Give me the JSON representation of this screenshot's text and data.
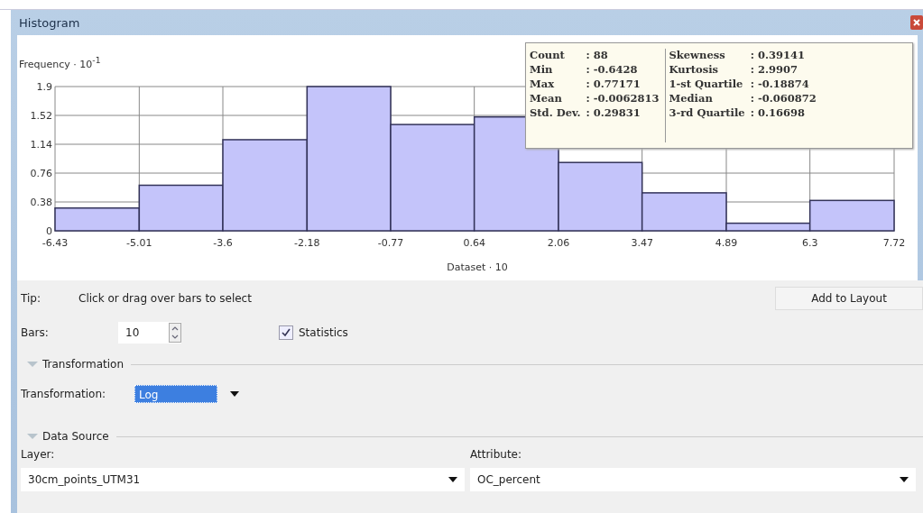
{
  "window": {
    "title": "Histogram"
  },
  "chart": {
    "chart_data": {
      "type": "bar",
      "ylabel": "Frequency · 10$^{-1}$",
      "xlabel": "Dataset · 10",
      "x": [
        -5.72,
        -4.305,
        -2.89,
        -1.475,
        -0.065,
        1.35,
        2.765,
        4.18,
        5.595,
        7.01
      ],
      "xticks": [
        {
          "value": -6.43,
          "label": "-6.43"
        },
        {
          "value": -5.01,
          "label": "-5.01"
        },
        {
          "value": -3.6,
          "label": "-3.6"
        },
        {
          "value": -2.18,
          "label": "-2.18"
        },
        {
          "value": -0.77,
          "label": "-0.77"
        },
        {
          "value": 0.64,
          "label": "0.64"
        },
        {
          "value": 2.06,
          "label": "2.06"
        },
        {
          "value": 3.47,
          "label": "3.47"
        },
        {
          "value": 4.89,
          "label": "4.89"
        },
        {
          "value": 6.3,
          "label": "6.3"
        },
        {
          "value": 7.72,
          "label": "7.72"
        }
      ],
      "yticks": [
        0,
        0.38,
        0.76,
        1.14,
        1.52,
        1.9
      ],
      "xlim": [
        -6.43,
        7.72
      ],
      "ylim": [
        0,
        1.9
      ],
      "grid": true,
      "series": [
        {
          "color": "#c4c4fa",
          "values": [
            0.3,
            0.6,
            1.2,
            1.9,
            1.4,
            1.5,
            0.9,
            0.5,
            0.1,
            0.4
          ]
        }
      ]
    }
  },
  "statistics_box": {
    "left": [
      {
        "label": "Count",
        "value": ": 88"
      },
      {
        "label": "Min",
        "value": ": -0.6428"
      },
      {
        "label": "Max",
        "value": ": 0.77171"
      },
      {
        "label": "Mean",
        "value": ": -0.0062813"
      },
      {
        "label": "Std. Dev.",
        "value": ": 0.29831"
      }
    ],
    "right": [
      {
        "label": "Skewness",
        "value": ": 0.39141"
      },
      {
        "label": "Kurtosis",
        "value": ": 2.9907"
      },
      {
        "label": "1-st Quartile",
        "value": ": -0.18874"
      },
      {
        "label": "Median",
        "value": ": -0.060872"
      },
      {
        "label": "3-rd Quartile",
        "value": ": 0.16698"
      }
    ]
  },
  "tip": {
    "label": "Tip:",
    "text": "Click or drag over bars to select"
  },
  "add_to_layout_button": "Add to Layout",
  "bars": {
    "label": "Bars:",
    "value": "10"
  },
  "statistics_checkbox": {
    "label": "Statistics",
    "checked": true
  },
  "transformation_section": {
    "title": "Transformation",
    "expanded": true,
    "label": "Transformation:",
    "value": "Log",
    "selected": true
  },
  "data_source_section": {
    "title": "Data Source",
    "expanded": true,
    "layer": {
      "label": "Layer:",
      "value": "30cm_points_UTM31"
    },
    "attribute": {
      "label": "Attribute:",
      "value": "OC_percent"
    }
  }
}
